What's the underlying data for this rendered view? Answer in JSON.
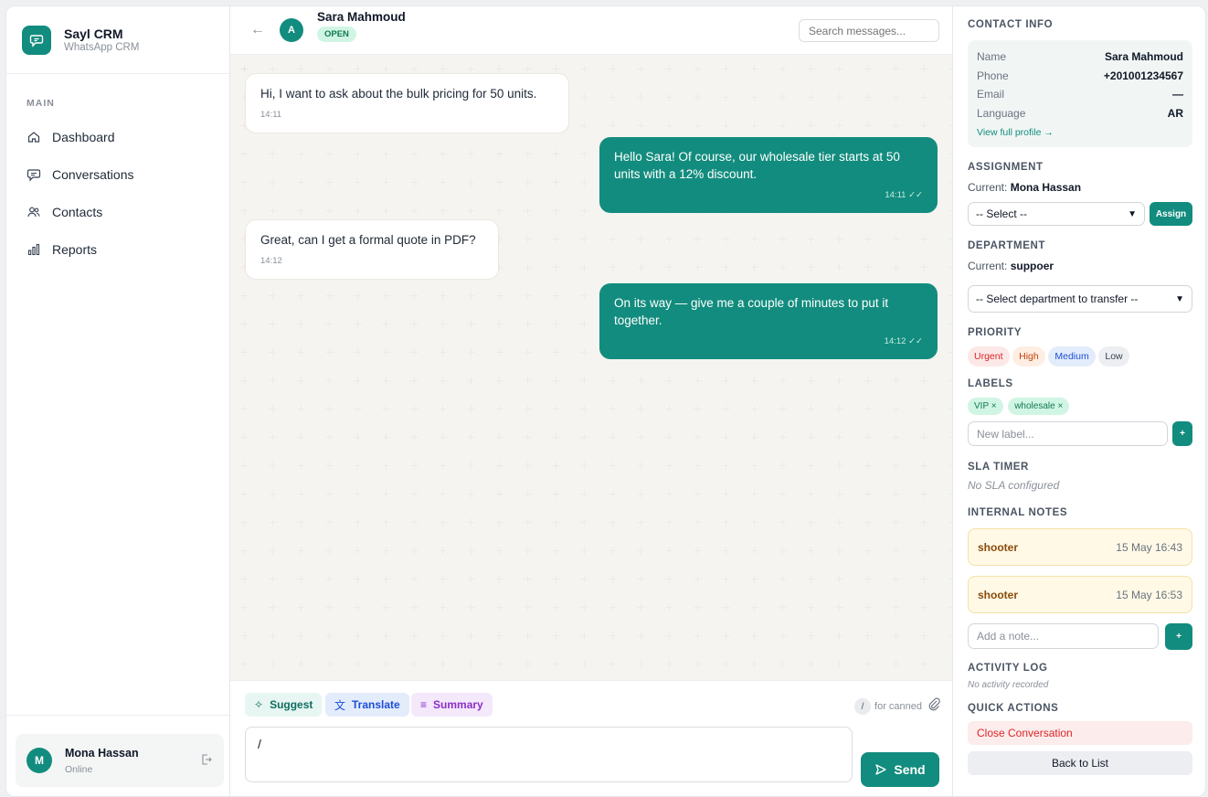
{
  "brand": {
    "name": "Sayl CRM",
    "subtitle": "WhatsApp CRM"
  },
  "sidebar": {
    "section": "MAIN",
    "items": [
      {
        "label": "Dashboard",
        "icon": "home-icon"
      },
      {
        "label": "Conversations",
        "icon": "chat-icon"
      },
      {
        "label": "Contacts",
        "icon": "users-icon"
      },
      {
        "label": "Reports",
        "icon": "bar-chart-icon"
      }
    ],
    "user": {
      "initial": "M",
      "name": "Mona Hassan",
      "status": "Online"
    }
  },
  "chat": {
    "contact_initial": "A",
    "contact_name": "Sara Mahmoud",
    "status": "OPEN",
    "search_placeholder": "Search messages...",
    "messages": [
      {
        "dir": "in",
        "text": "Hi, I want to ask about the bulk pricing for 50 units.",
        "time": "14:11"
      },
      {
        "dir": "out",
        "text": "Hello Sara! Of course, our wholesale tier starts at 50 units with a 12% discount.",
        "time": "14:11 ✓✓"
      },
      {
        "dir": "in",
        "text": "Great, can I get a formal quote in PDF?",
        "time": "14:12"
      },
      {
        "dir": "out",
        "text": "On its way — give me a couple of minutes to put it together.",
        "time": "14:12 ✓✓"
      }
    ],
    "composer": {
      "suggest": "Suggest",
      "translate": "Translate",
      "summary": "Summary",
      "canned_key": "/",
      "canned_hint": "for canned",
      "input_value": "/",
      "send": "Send"
    }
  },
  "panel": {
    "contact_info": {
      "title": "CONTACT INFO",
      "rows": [
        {
          "label": "Name",
          "value": "Sara Mahmoud"
        },
        {
          "label": "Phone",
          "value": "+201001234567"
        },
        {
          "label": "Email",
          "value": "—"
        },
        {
          "label": "Language",
          "value": "AR"
        }
      ],
      "link": "View full profile →"
    },
    "assignment": {
      "title": "ASSIGNMENT",
      "current_label": "Current:",
      "current": "Mona Hassan",
      "select": "-- Select --",
      "button": "Assign"
    },
    "department": {
      "title": "DEPARTMENT",
      "current_label": "Current:",
      "current": "suppoer",
      "select": "-- Select department to transfer --"
    },
    "priority": {
      "title": "PRIORITY",
      "options": [
        "Urgent",
        "High",
        "Medium",
        "Low"
      ]
    },
    "labels": {
      "title": "LABELS",
      "tags": [
        "VIP ×",
        "wholesale ×"
      ],
      "placeholder": "New label...",
      "add": "+"
    },
    "sla": {
      "title": "SLA TIMER",
      "text": "No SLA configured"
    },
    "notes": {
      "title": "INTERNAL NOTES",
      "items": [
        {
          "text": "shooter",
          "time": "15 May 16:43"
        },
        {
          "text": "shooter",
          "time": "15 May 16:53"
        }
      ],
      "placeholder": "Add a note...",
      "add": "+"
    },
    "activity": {
      "title": "ACTIVITY LOG",
      "text": "No activity recorded"
    },
    "quick_actions": {
      "title": "QUICK ACTIONS",
      "close": "Close Conversation",
      "back": "Back to List"
    }
  },
  "colors": {
    "accent": "#128c7e",
    "urgent": "#dc2626",
    "high": "#c2410c",
    "medium": "#1d4ed8",
    "low": "#374151"
  }
}
